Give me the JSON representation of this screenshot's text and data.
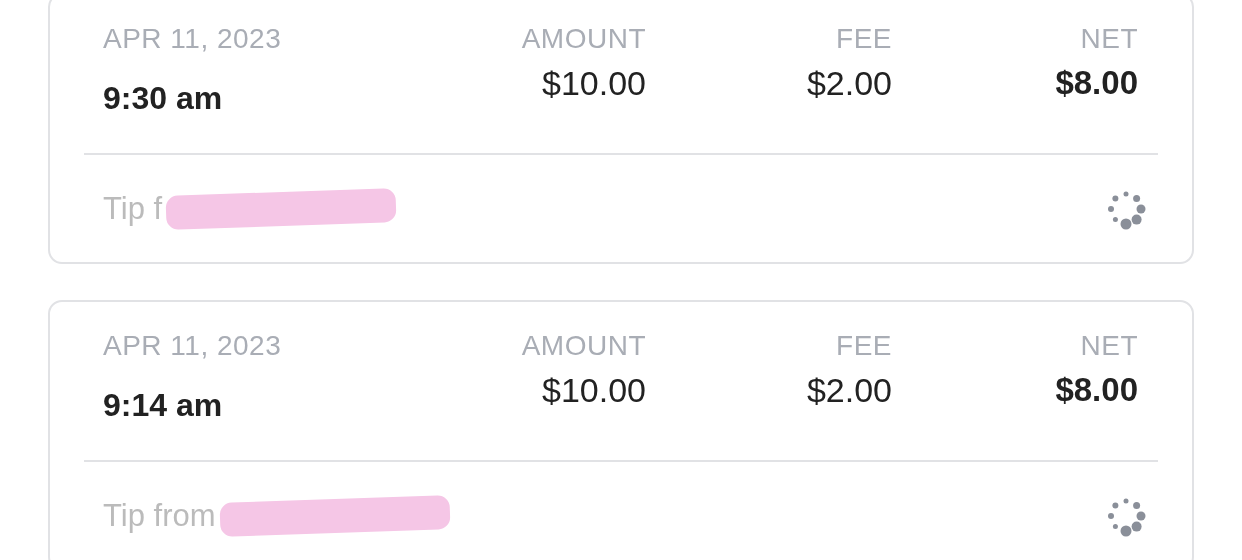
{
  "transactions": [
    {
      "date": "APR 11, 2023",
      "time": "9:30 am",
      "amount_label": "AMOUNT",
      "amount": "$10.00",
      "fee_label": "FEE",
      "fee": "$2.00",
      "net_label": "NET",
      "net": "$8.00",
      "description": "Tip f",
      "redacted": true
    },
    {
      "date": "APR 11, 2023",
      "time": "9:14 am",
      "amount_label": "AMOUNT",
      "amount": "$10.00",
      "fee_label": "FEE",
      "fee": "$2.00",
      "net_label": "NET",
      "net": "$8.00",
      "description": "Tip from",
      "redacted": true
    }
  ]
}
